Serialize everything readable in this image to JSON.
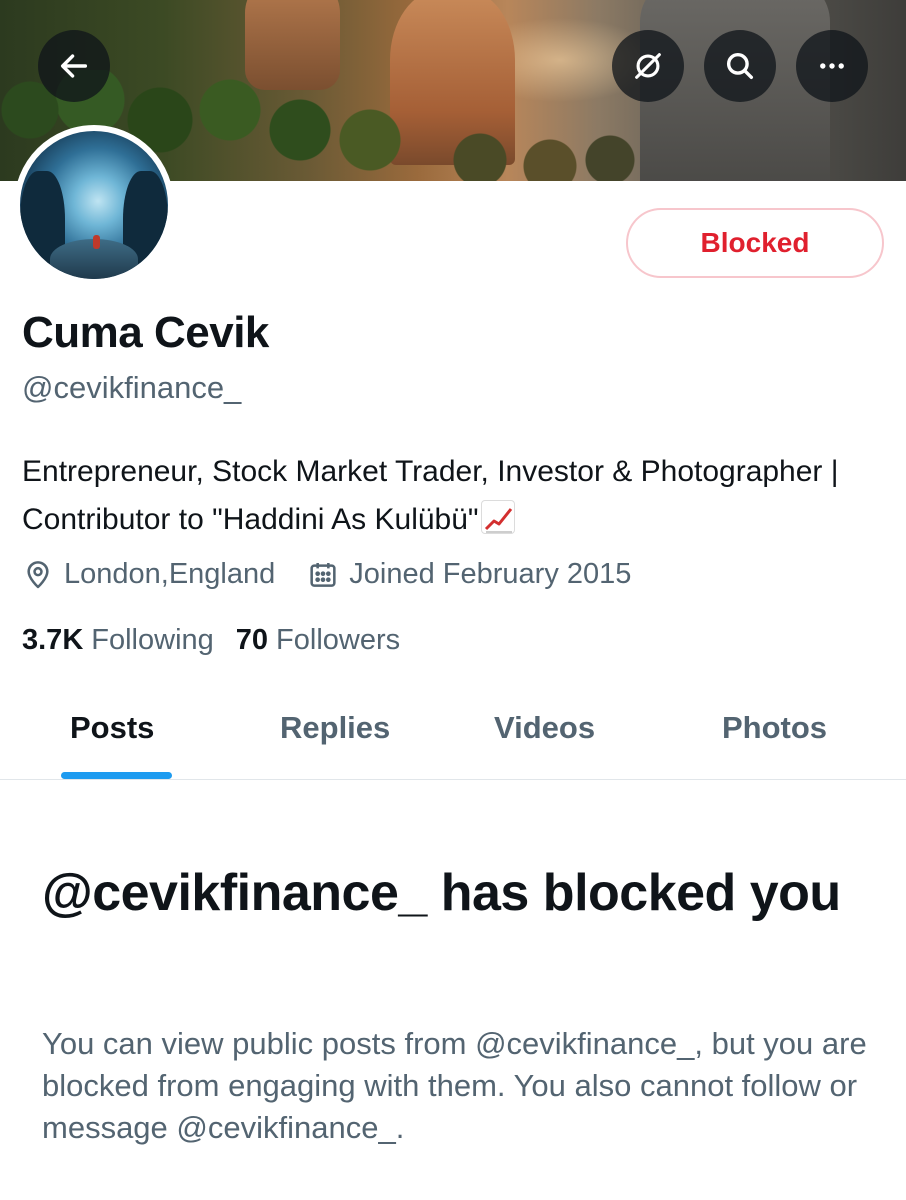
{
  "header": {
    "back_icon": "arrow-left-icon",
    "grok_icon": "slashed-circle-icon",
    "search_icon": "search-icon",
    "more_icon": "more-dots-icon"
  },
  "profile": {
    "name": "Cuma Cevik",
    "handle": "@cevikfinance_",
    "bio": "Entrepreneur, Stock Market Trader, Investor & Photographer | Contributor to \"Haddini As Kulübü\"",
    "location": "London,England",
    "joined": "Joined February 2015",
    "following_count": "3.7K",
    "following_label": "Following",
    "followers_count": "70",
    "followers_label": "Followers",
    "action_button": "Blocked"
  },
  "tabs": [
    {
      "label": "Posts",
      "active": true
    },
    {
      "label": "Replies",
      "active": false
    },
    {
      "label": "Videos",
      "active": false
    },
    {
      "label": "Photos",
      "active": false
    }
  ],
  "blocked_notice": {
    "title": "@cevikfinance_ has blocked you",
    "description": "You can view public posts from @cevikfinance_, but you are blocked from engaging with them. You also cannot follow or message @cevikfinance_."
  },
  "colors": {
    "blocked_red": "#e0202e",
    "accent_blue": "#1d9bf0",
    "secondary_text": "#536471"
  }
}
